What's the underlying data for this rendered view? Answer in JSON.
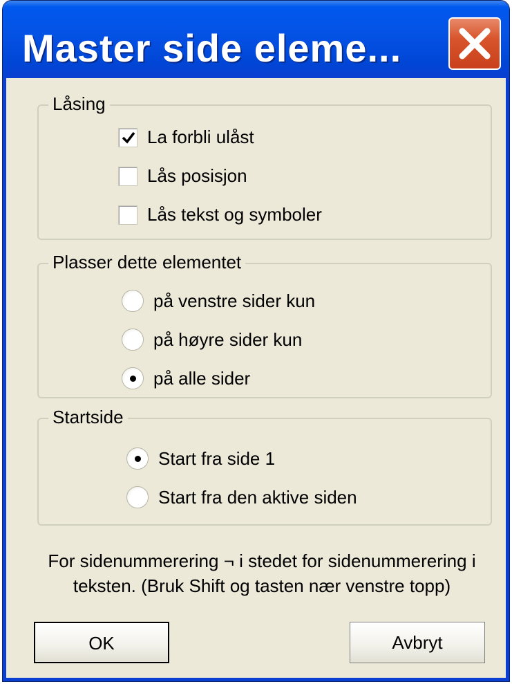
{
  "window": {
    "title": "Master side eleme..."
  },
  "locking": {
    "title": "Låsing",
    "options": [
      {
        "label": "La forbli ulåst",
        "checked": true
      },
      {
        "label": "Lås posisjon",
        "checked": false
      },
      {
        "label": "Lås tekst og symboler",
        "checked": false
      }
    ]
  },
  "placement": {
    "title": "Plasser dette elementet",
    "options": [
      {
        "label": "på venstre sider kun",
        "selected": false
      },
      {
        "label": "på høyre sider kun",
        "selected": false
      },
      {
        "label": "på alle sider",
        "selected": true
      }
    ]
  },
  "start_page": {
    "title": "Startside",
    "options": [
      {
        "label": "Start fra side 1",
        "selected": true
      },
      {
        "label": "Start fra den aktive siden",
        "selected": false
      }
    ]
  },
  "note": {
    "line1": "For sidenummerering ¬ i stedet for sidenummerering i",
    "line2": "teksten. (Bruk Shift og tasten nær venstre topp)"
  },
  "buttons": {
    "ok_label": "OK",
    "cancel_label": "Avbryt"
  },
  "icons": {
    "close": "close-x-icon",
    "checkmark": "checkmark-icon",
    "radio_dot": "radio-dot-icon"
  },
  "colors": {
    "titlebar": "#0553e6",
    "dialog_background": "#ece9d8",
    "close_button": "#d8552c"
  }
}
